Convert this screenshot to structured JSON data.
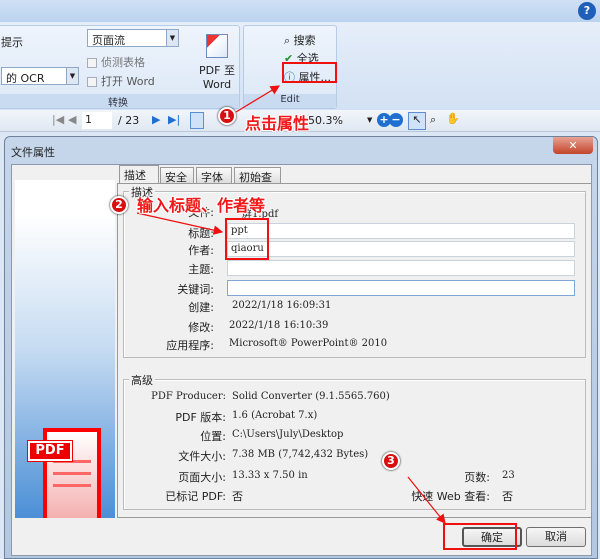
{
  "ribbon": {
    "hint_label": "提示",
    "ocr_select": "的 OCR",
    "layout_select": "页面流",
    "detect_tables": "侦测表格",
    "open_word": "打开 Word",
    "pdf_to_word": "PDF 至 Word",
    "convert_group": "转换",
    "search": "搜索",
    "select_all": "全选",
    "properties": "属性...",
    "edit_group": "Edit",
    "help_icon": "question-icon"
  },
  "toolbar": {
    "page": "1",
    "page_total": "/ 23",
    "zoom": "50.3%"
  },
  "dialog": {
    "title": "文件属性",
    "tabs": [
      "描述",
      "安全",
      "字体",
      "初始查看"
    ],
    "desc": {
      "legend": "描述",
      "file_label": "文件:",
      "file_value": "屏1.pdf",
      "title_label": "标题:",
      "title_value": "ppt",
      "author_label": "作者:",
      "author_value": "qiaoru",
      "subject_label": "主题:",
      "subject_value": "",
      "keywords_label": "关键词:",
      "keywords_value": "",
      "created_label": "创建:",
      "created_value": "2022/1/18 16:09:31",
      "modified_label": "修改:",
      "modified_value": "2022/1/18 16:10:39",
      "app_label": "应用程序:",
      "app_value": "Microsoft® PowerPoint® 2010"
    },
    "adv": {
      "legend": "高级",
      "producer_label": "PDF Producer:",
      "producer_value": "Solid Converter (9.1.5565.760)",
      "version_label": "PDF 版本:",
      "version_value": "1.6 (Acrobat 7.x)",
      "location_label": "位置:",
      "location_value": "C:\\Users\\July\\Desktop",
      "filesize_label": "文件大小:",
      "filesize_value": "7.38 MB (7,742,432 Bytes)",
      "pagesize_label": "页面大小:",
      "pagesize_value": "13.33 x 7.50 in",
      "pages_label": "页数:",
      "pages_value": "23",
      "tagged_label": "已标记 PDF:",
      "tagged_value": "否",
      "fastweb_label": "快速 Web 查看:",
      "fastweb_value": "否"
    },
    "ok": "确定",
    "cancel": "取消",
    "pdf_logo": "PDF"
  },
  "annotations": {
    "step1": "1",
    "step1_text": "点击属性",
    "step2": "2",
    "step2_text": "输入标题、作者等",
    "step3": "3",
    "color": "#f01010"
  }
}
